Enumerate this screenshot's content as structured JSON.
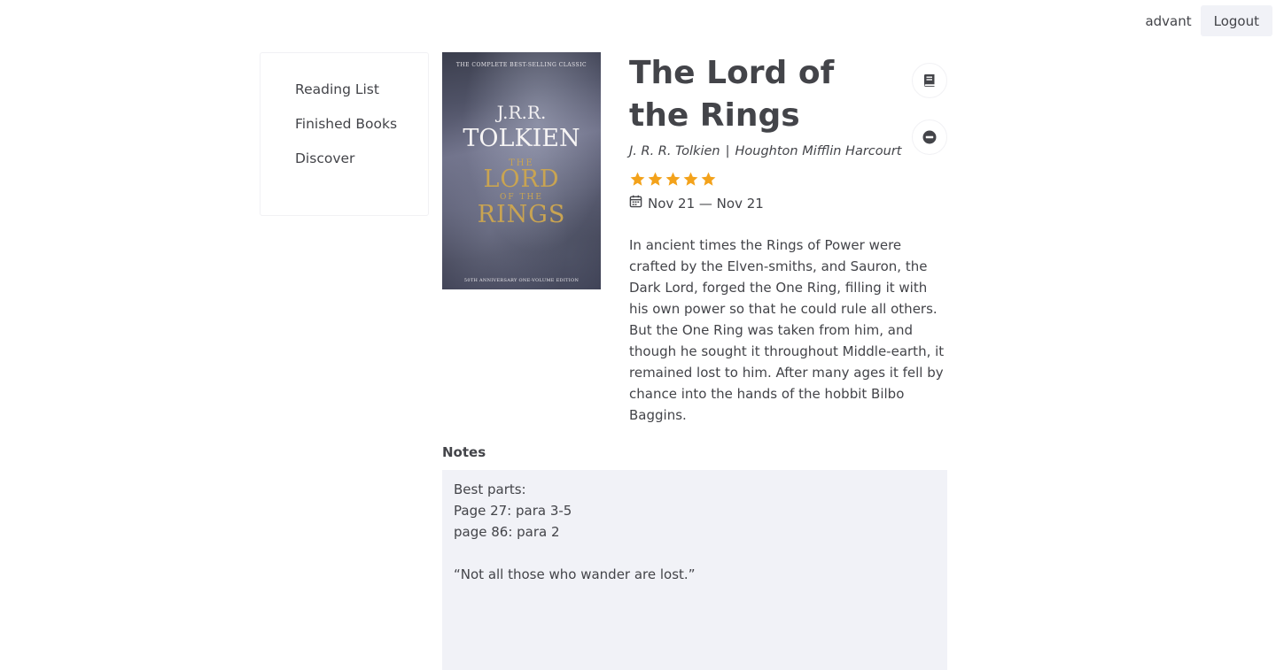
{
  "header": {
    "username": "advant",
    "logout_label": "Logout"
  },
  "sidebar": {
    "items": [
      {
        "label": "Reading List"
      },
      {
        "label": "Finished Books"
      },
      {
        "label": "Discover"
      }
    ]
  },
  "book": {
    "title": "The Lord of the Rings",
    "author": "J. R. R. Tolkien",
    "separator": "|",
    "publisher": "Houghton Mifflin Harcourt",
    "rating": 5,
    "rating_max": 5,
    "star_color": "#f3a21b",
    "dates": "Nov 21 — Nov 21",
    "synopsis": "In ancient times the Rings of Power were crafted by the Elven-smiths, and Sauron, the Dark Lord, forged the One Ring, filling it with his own power so that he could rule all others. But the One Ring was taken from him, and though he sought it throughout Middle-earth, it remained lost to him. After many ages it fell by chance into the hands of the hobbit Bilbo Baggins.",
    "cover": {
      "top_text": "THE COMPLETE BEST-SELLING CLASSIC",
      "author_line1": "J.R.R.",
      "author_line2": "TOLKIEN",
      "title_line1": "THE",
      "title_line2": "LORD",
      "title_line3": "OF THE",
      "title_line4": "RINGS",
      "bottom_text": "50TH ANNIVERSARY ONE-VOLUME EDITION"
    }
  },
  "actions": {
    "mark_read_icon": "book-icon",
    "remove_icon": "minus-circle-icon"
  },
  "notes": {
    "label": "Notes",
    "value": "Best parts:\nPage 27: para 3-5\npage 86: para 2\n\n“Not all those who wander are lost.”"
  }
}
